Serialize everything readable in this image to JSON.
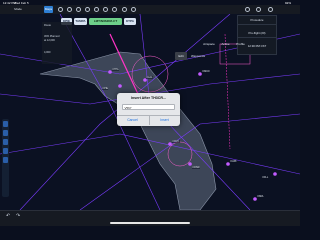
{
  "status_bar": {
    "time": "12:42 PM",
    "date": "Wed Feb 5",
    "battery": "92%"
  },
  "toolbar": {
    "buttons": {
      "menu": "Mode",
      "maps": "Maps",
      "layers": "Layers",
      "more": "More"
    }
  },
  "route_chips": [
    "KPIE",
    "TAMPA",
    "LMT/N3S2R/LCT",
    "KTPA"
  ],
  "route_panel": {
    "header": "Route",
    "lines": [
      "30% Planned",
      "at 12,000",
      "4,000"
    ]
  },
  "right_menu": {
    "items": [
      "Procedure",
      "Pre-flight (20)",
      "12:30 PM CST"
    ]
  },
  "map_tabs": [
    "Airspace",
    "Active",
    "Profile",
    "Edit",
    "Waypoints"
  ],
  "dialog": {
    "title": "Insert After TH3CR...",
    "input_value": "V567",
    "cancel_label": "Cancel",
    "insert_label": "Insert"
  },
  "map_labels": [
    {
      "text": "KTPA"
    },
    {
      "text": "KPIE"
    },
    {
      "text": "KLAL"
    },
    {
      "text": "KSRQ"
    },
    {
      "text": "KMCO"
    },
    {
      "text": "KFMY"
    },
    {
      "text": "KRSW"
    },
    {
      "text": "KAPF"
    },
    {
      "text": "KMIA"
    },
    {
      "text": "KFLL"
    }
  ],
  "bottom_bar": {
    "undo": "↶",
    "redo": "↷"
  },
  "colors": {
    "accent": "#2f7fd3",
    "green_chip": "#6ed08a",
    "airway": "#7a3cff"
  }
}
